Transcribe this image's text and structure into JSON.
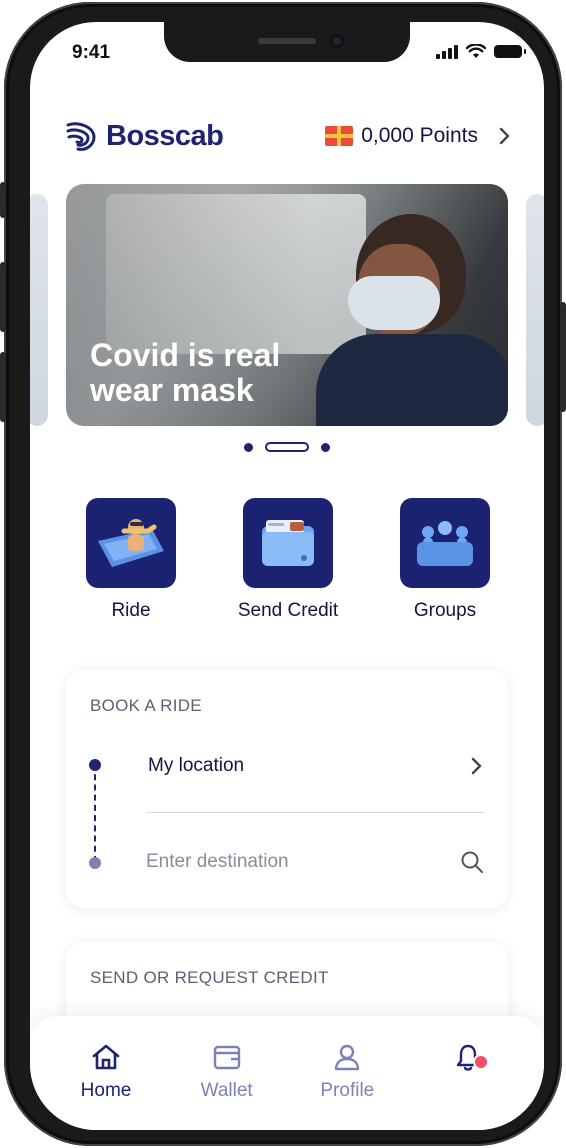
{
  "status_bar": {
    "time": "9:41"
  },
  "header": {
    "brand": "Bosscab",
    "points_label": "0,000 Points",
    "gift_icon": "gift-card-icon",
    "chevron_icon": "chevron-right-icon"
  },
  "carousel": {
    "caption": "Covid is real wear mask",
    "page_count": 3,
    "active_page": 2
  },
  "actions": [
    {
      "label": "Ride",
      "icon": "ride-icon"
    },
    {
      "label": "Send Credit",
      "icon": "wallet-credit-icon"
    },
    {
      "label": "Groups",
      "icon": "groups-icon"
    }
  ],
  "book_ride": {
    "title": "BOOK A RIDE",
    "my_location": "My location",
    "destination_placeholder": "Enter destination"
  },
  "credit_card": {
    "title": "SEND OR REQUEST CREDIT"
  },
  "tabbar": {
    "items": [
      {
        "label": "Home",
        "icon": "home-icon",
        "active": true
      },
      {
        "label": "Wallet",
        "icon": "wallet-icon",
        "active": false
      },
      {
        "label": "Profile",
        "icon": "profile-icon",
        "active": false
      },
      {
        "label": "",
        "icon": "bell-icon",
        "active": false,
        "badge": true
      }
    ]
  },
  "colors": {
    "brand": "#1F2470",
    "tile": "#1C2272",
    "inactive": "#7D81B4",
    "badge": "#F0506A"
  }
}
